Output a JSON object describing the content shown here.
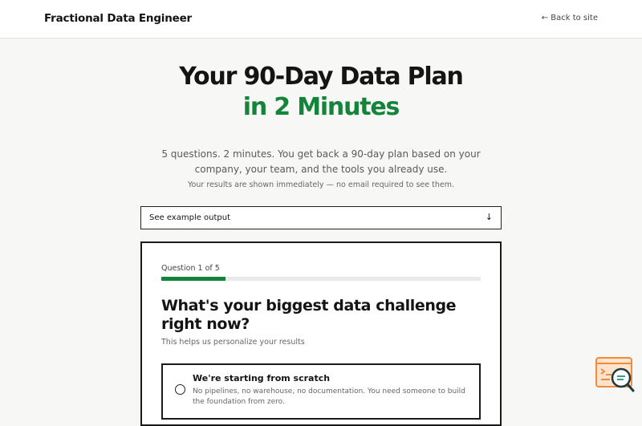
{
  "header": {
    "brand": "Fractional Data Engineer",
    "back_link": "← Back to site"
  },
  "hero": {
    "title_line1": "Your 90-Day Data Plan",
    "title_line2": "in 2 Minutes",
    "description": "5 questions. 2 minutes. You get back a 90-day plan based on your company, your team, and the tools you already use.",
    "note": "Your results are shown immediately — no email required to see them."
  },
  "example": {
    "label": "See example output",
    "arrow": "↓"
  },
  "quiz": {
    "question_label": "Question 1 of 5",
    "progress": 0.2,
    "question": "What's your biggest data challenge right now?",
    "subtitle": "This helps us personalize your results",
    "options": [
      {
        "title": "We're starting from scratch",
        "description": "No pipelines, no warehouse, no documentation. You need someone to build the foundation from zero."
      }
    ]
  },
  "colors": {
    "accent": "#13843a",
    "widget": "#f28c3a"
  },
  "icons": {
    "widget": "search-chat-icon"
  }
}
